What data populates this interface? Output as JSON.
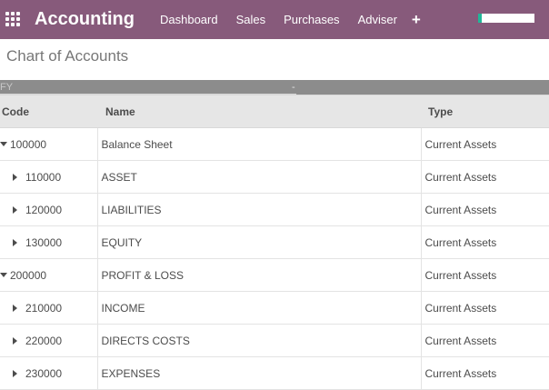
{
  "navbar": {
    "brand": "Accounting",
    "menu": [
      "Dashboard",
      "Sales",
      "Purchases",
      "Adviser"
    ],
    "plus": "+"
  },
  "page": {
    "title": "Chart of Accounts"
  },
  "filter": {
    "label": "FY",
    "separator": "-"
  },
  "table": {
    "headers": {
      "code": "Code",
      "name": "Name",
      "type": "Type"
    },
    "rows": [
      {
        "code": "100000",
        "name": "Balance Sheet",
        "type": "Current Assets",
        "expanded": true
      },
      {
        "code": "110000",
        "name": "ASSET",
        "type": "Current Assets",
        "expanded": false
      },
      {
        "code": "120000",
        "name": "LIABILITIES",
        "type": "Current Assets",
        "expanded": false
      },
      {
        "code": "130000",
        "name": "EQUITY",
        "type": "Current Assets",
        "expanded": false
      },
      {
        "code": "200000",
        "name": "PROFIT & LOSS",
        "type": "Current Assets",
        "expanded": true
      },
      {
        "code": "210000",
        "name": "INCOME",
        "type": "Current Assets",
        "expanded": false
      },
      {
        "code": "220000",
        "name": "DIRECTS COSTS",
        "type": "Current Assets",
        "expanded": false
      },
      {
        "code": "230000",
        "name": "EXPENSES",
        "type": "Current Assets",
        "expanded": false
      }
    ]
  },
  "colors": {
    "navbar": "#875a7b",
    "accent": "#21b799"
  }
}
